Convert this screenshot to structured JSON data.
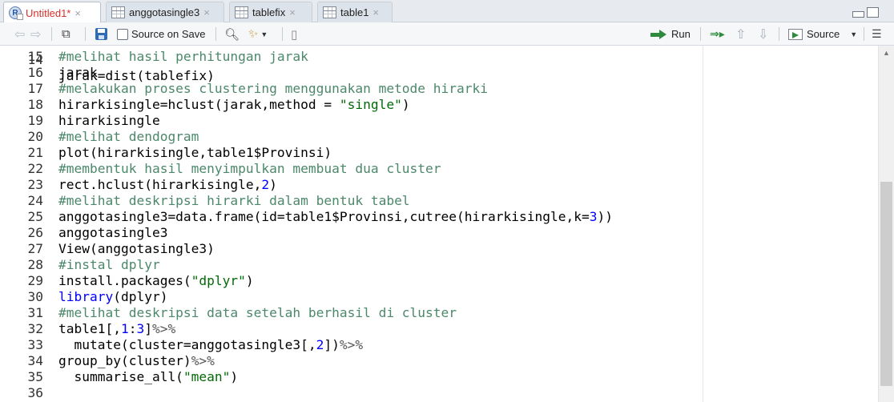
{
  "tabs": [
    {
      "label": "Untitled1*",
      "icon": "r-script-icon",
      "active": true
    },
    {
      "label": "anggotasingle3",
      "icon": "table-icon",
      "active": false
    },
    {
      "label": "tablefix",
      "icon": "table-icon",
      "active": false
    },
    {
      "label": "table1",
      "icon": "table-icon",
      "active": false
    }
  ],
  "tab_close_glyph": "×",
  "toolbar": {
    "source_on_save_label": "Source on Save",
    "run_label": "Run",
    "source_label": "Source"
  },
  "partial_top_line": "jarak=dist(tablefix)",
  "lines": [
    {
      "n": "15",
      "t": "#melihat hasil perhitungan jarak"
    },
    {
      "n": "16",
      "t": "jarak"
    },
    {
      "n": "17",
      "t": "#melakukan proses clustering menggunakan metode hirarki"
    },
    {
      "n": "18",
      "t": "hirarkisingle=hclust(jarak,method = \"single\")"
    },
    {
      "n": "19",
      "t": "hirarkisingle"
    },
    {
      "n": "20",
      "t": "#melihat dendogram"
    },
    {
      "n": "21",
      "t": "plot(hirarkisingle,table1$Provinsi)"
    },
    {
      "n": "22",
      "t": "#membentuk hasil menyimpulkan membuat dua cluster"
    },
    {
      "n": "23",
      "t": "rect.hclust(hirarkisingle,2)"
    },
    {
      "n": "24",
      "t": "#melihat deskripsi hirarki dalam bentuk tabel"
    },
    {
      "n": "25",
      "t": "anggotasingle3=data.frame(id=table1$Provinsi,cutree(hirarkisingle,k=3))"
    },
    {
      "n": "26",
      "t": "anggotasingle3"
    },
    {
      "n": "27",
      "t": "View(anggotasingle3)"
    },
    {
      "n": "28",
      "t": "#instal dplyr"
    },
    {
      "n": "29",
      "t": "install.packages(\"dplyr\")"
    },
    {
      "n": "30",
      "t": "library(dplyr)"
    },
    {
      "n": "31",
      "t": "#melihat deskripsi data setelah berhasil di cluster"
    },
    {
      "n": "32",
      "t": "table1[,1:3]%>%"
    },
    {
      "n": "33",
      "t": "  mutate(cluster=anggotasingle3[,2])%>%"
    },
    {
      "n": "34",
      "t": "group_by(cluster)%>%"
    },
    {
      "n": "35",
      "t": "  summarise_all(\"mean\")"
    },
    {
      "n": "36",
      "t": ""
    }
  ],
  "colors": {
    "comment": "#4c886b",
    "string": "#036a07",
    "number": "#0000ff",
    "active_tab_text": "#d6312a"
  }
}
